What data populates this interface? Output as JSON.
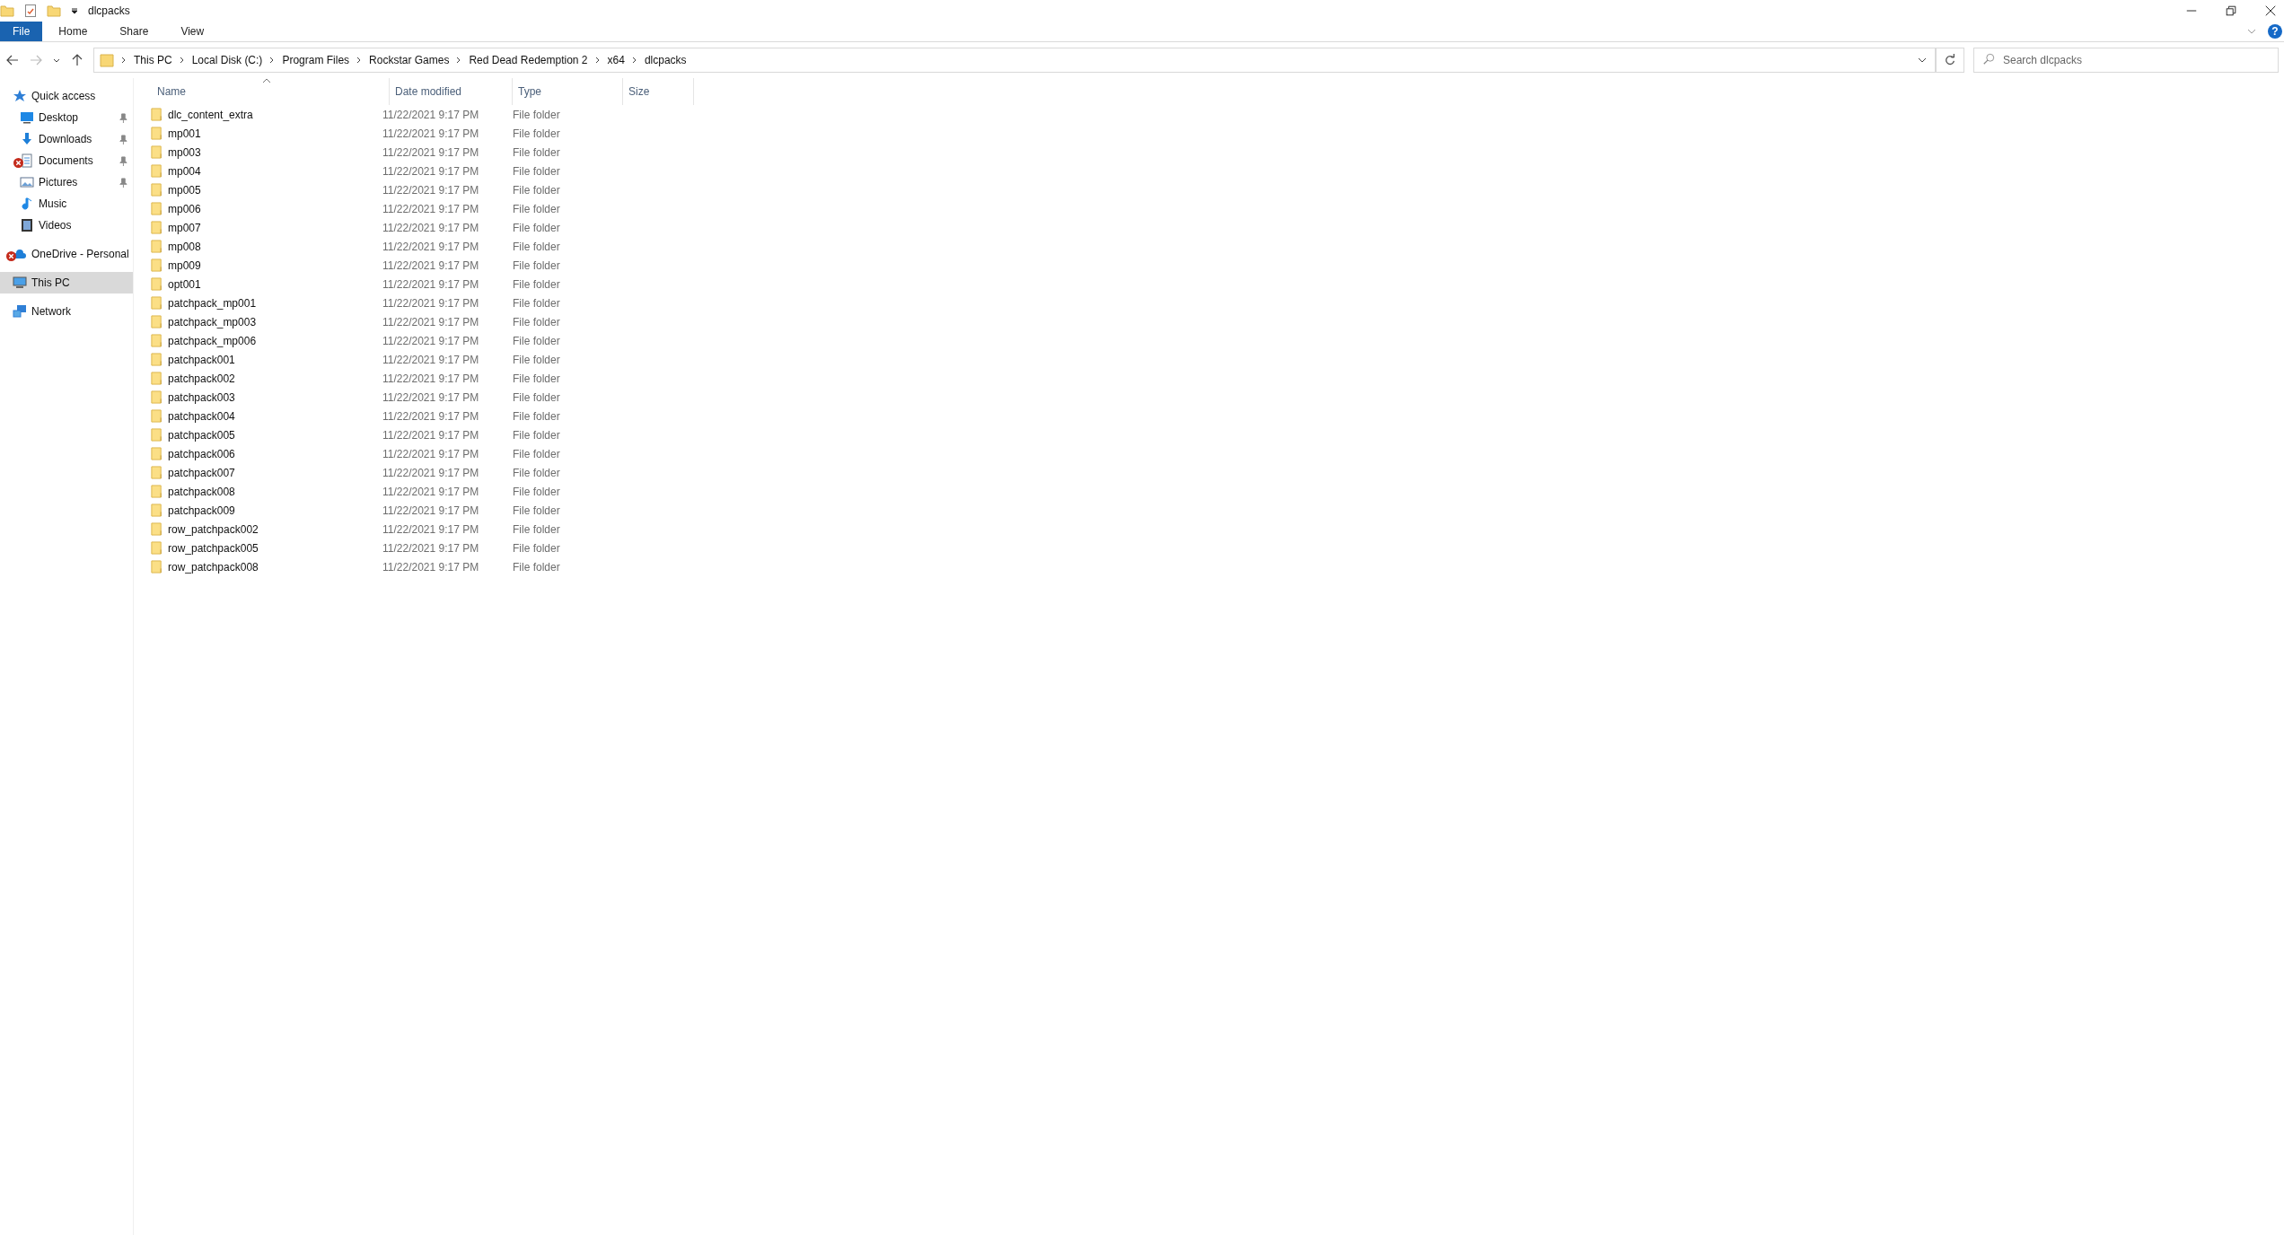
{
  "window": {
    "title": "dlcpacks"
  },
  "ribbon": {
    "help": "?",
    "tabs": [
      {
        "label": "File",
        "selected": true
      },
      {
        "label": "Home",
        "selected": false
      },
      {
        "label": "Share",
        "selected": false
      },
      {
        "label": "View",
        "selected": false
      }
    ]
  },
  "address_bar": {
    "breadcrumbs": [
      "This PC",
      "Local Disk (C:)",
      "Program Files",
      "Rockstar Games",
      "Red Dead Redemption 2",
      "x64",
      "dlcpacks"
    ]
  },
  "search": {
    "placeholder": "Search dlcpacks"
  },
  "sidebar": {
    "items": [
      {
        "label": "Quick access",
        "kind": "star",
        "level2": false,
        "pinned": false,
        "error": false,
        "selected": false
      },
      {
        "label": "Desktop",
        "kind": "desktop",
        "level2": true,
        "pinned": true,
        "error": false,
        "selected": false
      },
      {
        "label": "Downloads",
        "kind": "download",
        "level2": true,
        "pinned": true,
        "error": false,
        "selected": false
      },
      {
        "label": "Documents",
        "kind": "document",
        "level2": true,
        "pinned": true,
        "error": true,
        "selected": false
      },
      {
        "label": "Pictures",
        "kind": "picture",
        "level2": true,
        "pinned": true,
        "error": false,
        "selected": false
      },
      {
        "label": "Music",
        "kind": "music",
        "level2": true,
        "pinned": false,
        "error": false,
        "selected": false
      },
      {
        "label": "Videos",
        "kind": "video",
        "level2": true,
        "pinned": false,
        "error": false,
        "selected": false
      },
      {
        "label": "OneDrive - Personal",
        "kind": "cloud",
        "level2": false,
        "pinned": false,
        "error": true,
        "selected": false
      },
      {
        "label": "This PC",
        "kind": "pc",
        "level2": false,
        "pinned": false,
        "error": false,
        "selected": true
      },
      {
        "label": "Network",
        "kind": "network",
        "level2": false,
        "pinned": false,
        "error": false,
        "selected": false
      }
    ]
  },
  "table": {
    "columns": [
      {
        "label": "Name",
        "sorted": true
      },
      {
        "label": "Date modified",
        "sorted": false
      },
      {
        "label": "Type",
        "sorted": false
      },
      {
        "label": "Size",
        "sorted": false
      }
    ],
    "rows": [
      {
        "name": "dlc_content_extra",
        "date": "11/22/2021 9:17 PM",
        "type": "File folder"
      },
      {
        "name": "mp001",
        "date": "11/22/2021 9:17 PM",
        "type": "File folder"
      },
      {
        "name": "mp003",
        "date": "11/22/2021 9:17 PM",
        "type": "File folder"
      },
      {
        "name": "mp004",
        "date": "11/22/2021 9:17 PM",
        "type": "File folder"
      },
      {
        "name": "mp005",
        "date": "11/22/2021 9:17 PM",
        "type": "File folder"
      },
      {
        "name": "mp006",
        "date": "11/22/2021 9:17 PM",
        "type": "File folder"
      },
      {
        "name": "mp007",
        "date": "11/22/2021 9:17 PM",
        "type": "File folder"
      },
      {
        "name": "mp008",
        "date": "11/22/2021 9:17 PM",
        "type": "File folder"
      },
      {
        "name": "mp009",
        "date": "11/22/2021 9:17 PM",
        "type": "File folder"
      },
      {
        "name": "opt001",
        "date": "11/22/2021 9:17 PM",
        "type": "File folder"
      },
      {
        "name": "patchpack_mp001",
        "date": "11/22/2021 9:17 PM",
        "type": "File folder"
      },
      {
        "name": "patchpack_mp003",
        "date": "11/22/2021 9:17 PM",
        "type": "File folder"
      },
      {
        "name": "patchpack_mp006",
        "date": "11/22/2021 9:17 PM",
        "type": "File folder"
      },
      {
        "name": "patchpack001",
        "date": "11/22/2021 9:17 PM",
        "type": "File folder"
      },
      {
        "name": "patchpack002",
        "date": "11/22/2021 9:17 PM",
        "type": "File folder"
      },
      {
        "name": "patchpack003",
        "date": "11/22/2021 9:17 PM",
        "type": "File folder"
      },
      {
        "name": "patchpack004",
        "date": "11/22/2021 9:17 PM",
        "type": "File folder"
      },
      {
        "name": "patchpack005",
        "date": "11/22/2021 9:17 PM",
        "type": "File folder"
      },
      {
        "name": "patchpack006",
        "date": "11/22/2021 9:17 PM",
        "type": "File folder"
      },
      {
        "name": "patchpack007",
        "date": "11/22/2021 9:17 PM",
        "type": "File folder"
      },
      {
        "name": "patchpack008",
        "date": "11/22/2021 9:17 PM",
        "type": "File folder"
      },
      {
        "name": "patchpack009",
        "date": "11/22/2021 9:17 PM",
        "type": "File folder"
      },
      {
        "name": "row_patchpack002",
        "date": "11/22/2021 9:17 PM",
        "type": "File folder"
      },
      {
        "name": "row_patchpack005",
        "date": "11/22/2021 9:17 PM",
        "type": "File folder"
      },
      {
        "name": "row_patchpack008",
        "date": "11/22/2021 9:17 PM",
        "type": "File folder"
      }
    ]
  }
}
